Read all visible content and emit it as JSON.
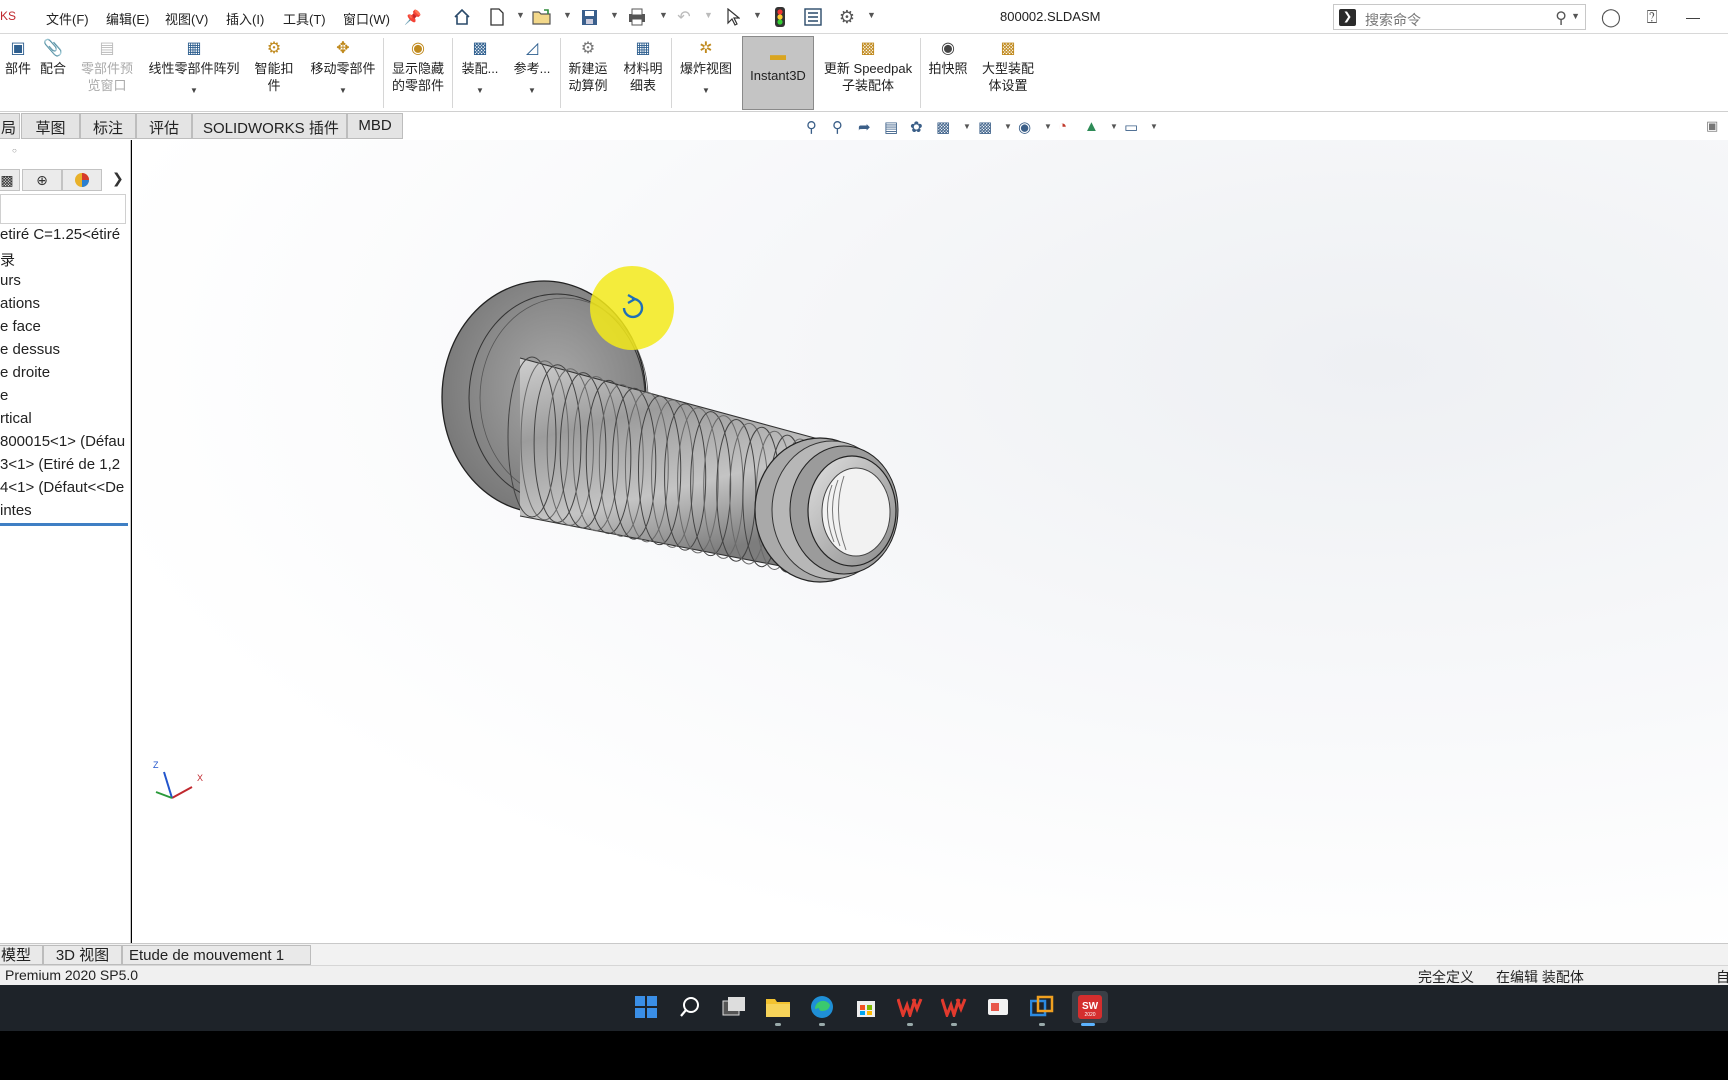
{
  "app": {
    "brand_fragment": "KS",
    "document_title": "800002.SLDASM"
  },
  "menu": [
    {
      "id": "file",
      "label": "文件(F)"
    },
    {
      "id": "edit",
      "label": "编辑(E)"
    },
    {
      "id": "view",
      "label": "视图(V)"
    },
    {
      "id": "insert",
      "label": "插入(I)"
    },
    {
      "id": "tools",
      "label": "工具(T)"
    },
    {
      "id": "window",
      "label": "窗口(W)"
    }
  ],
  "search": {
    "placeholder": "搜索命令"
  },
  "ribbon": [
    {
      "id": "insert-component",
      "lines": [
        "部件"
      ],
      "icon": "component-icon"
    },
    {
      "id": "mate",
      "lines": [
        "配合"
      ],
      "icon": "paperclip-icon"
    },
    {
      "id": "component-preview",
      "lines": [
        "零部件预",
        "览窗口"
      ],
      "icon": "preview-icon",
      "disabled": true
    },
    {
      "id": "linear-pattern",
      "lines": [
        "线性零部件阵列"
      ],
      "icon": "pattern-icon",
      "dropdown": true
    },
    {
      "id": "smart-fasteners",
      "lines": [
        "智能扣",
        "件"
      ],
      "icon": "fastener-icon"
    },
    {
      "id": "move-component",
      "lines": [
        "移动零部件"
      ],
      "icon": "move-icon",
      "dropdown": true
    },
    {
      "id": "show-hidden",
      "lines": [
        "显示隐藏",
        "的零部件"
      ],
      "icon": "show-hidden-icon"
    },
    {
      "id": "assembly-features",
      "lines": [
        "装配..."
      ],
      "icon": "assembly-feature-icon",
      "dropdown": true
    },
    {
      "id": "reference-geometry",
      "lines": [
        "参考..."
      ],
      "icon": "reference-icon",
      "dropdown": true
    },
    {
      "id": "new-motion-study",
      "lines": [
        "新建运",
        "动算例"
      ],
      "icon": "motion-icon"
    },
    {
      "id": "bill-of-materials",
      "lines": [
        "材料明",
        "细表"
      ],
      "icon": "bom-icon"
    },
    {
      "id": "exploded-view",
      "lines": [
        "爆炸视图"
      ],
      "icon": "explode-icon",
      "dropdown": true
    },
    {
      "id": "instant3d",
      "lines": [
        "Instant3D"
      ],
      "icon": "instant3d-icon",
      "active": true
    },
    {
      "id": "update-speedpak",
      "lines": [
        "更新 Speedpak",
        "子装配体"
      ],
      "icon": "speedpak-icon"
    },
    {
      "id": "take-snapshot",
      "lines": [
        "拍快照"
      ],
      "icon": "camera-icon"
    },
    {
      "id": "large-assembly",
      "lines": [
        "大型装配",
        "体设置"
      ],
      "icon": "large-assembly-icon"
    }
  ],
  "tabs": [
    {
      "id": "layout",
      "label": "局"
    },
    {
      "id": "sketch",
      "label": "草图"
    },
    {
      "id": "markup",
      "label": "标注"
    },
    {
      "id": "evaluate",
      "label": "评估"
    },
    {
      "id": "addins",
      "label": "SOLIDWORKS 插件"
    },
    {
      "id": "mbd",
      "label": "MBD"
    }
  ],
  "tree": [
    "etiré C=1.25<étiré",
    "录",
    "urs",
    "ations",
    "e face",
    "e dessus",
    "e droite",
    "e",
    "rtical",
    "800015<1> (Défau",
    "3<1> (Etiré de 1,2",
    "4<1> (Défaut<<De",
    "intes"
  ],
  "triad": {
    "z": "Z",
    "x": "X"
  },
  "bottom_tabs": [
    {
      "id": "model",
      "label": "模型"
    },
    {
      "id": "3d-view",
      "label": "3D 视图"
    },
    {
      "id": "motion-study",
      "label": "Etude de mouvement 1"
    }
  ],
  "status": {
    "version": "Premium 2020 SP5.0",
    "definition": "完全定义",
    "editing": "在编辑 装配体",
    "custom": "自"
  },
  "taskbar": [
    {
      "id": "start",
      "icon": "windows-start-icon",
      "color": "#3a8ee6"
    },
    {
      "id": "search",
      "icon": "search-icon",
      "color": "#ffffff"
    },
    {
      "id": "taskview",
      "icon": "task-view-icon",
      "color": "#dddddd"
    },
    {
      "id": "explorer",
      "icon": "folder-icon",
      "color": "#f2c230"
    },
    {
      "id": "edge",
      "icon": "edge-icon",
      "color": "#2fb4c9"
    },
    {
      "id": "store",
      "icon": "store-icon",
      "color": "#eeeeee"
    },
    {
      "id": "wps1",
      "icon": "wps-icon",
      "color": "#e23a2e"
    },
    {
      "id": "wps2",
      "icon": "wps-icon",
      "color": "#e23a2e"
    },
    {
      "id": "app1",
      "icon": "presentation-icon",
      "color": "#e8574a"
    },
    {
      "id": "app2",
      "icon": "window-switch-icon",
      "color": "#f0a020"
    },
    {
      "id": "solidworks",
      "icon": "solidworks-icon",
      "color": "#d42e2e",
      "label": "SW",
      "sub": "2020"
    }
  ]
}
